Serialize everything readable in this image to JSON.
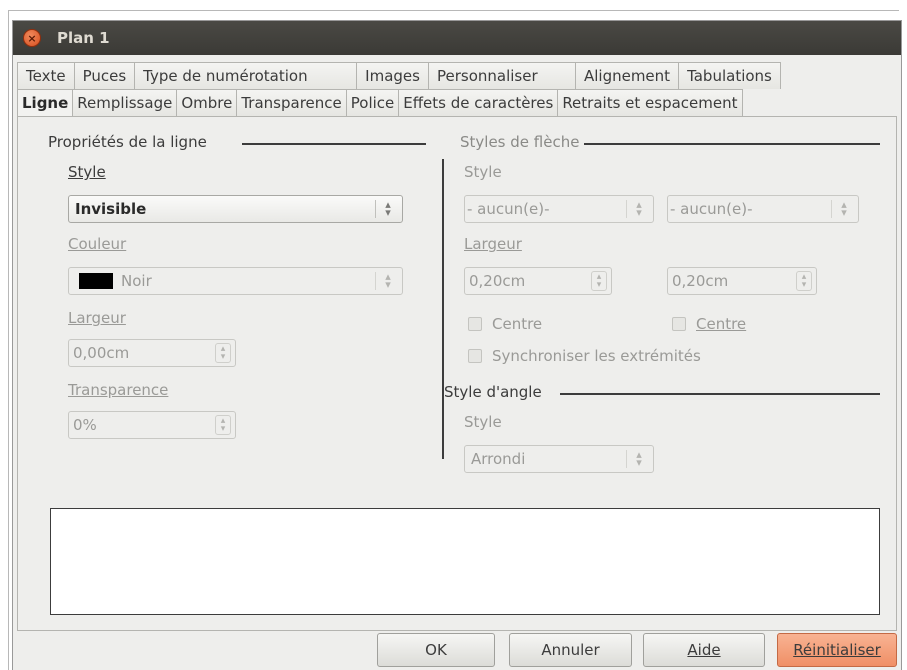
{
  "window": {
    "title": "Plan 1"
  },
  "tabs_row1": [
    "Texte",
    "Puces",
    "Type de numérotation",
    "Images",
    "Personnaliser",
    "Alignement",
    "Tabulations"
  ],
  "tabs_row2": [
    "Ligne",
    "Remplissage",
    "Ombre",
    "Transparence",
    "Police",
    "Effets de caractères",
    "Retraits et espacement"
  ],
  "active_tab": "Ligne",
  "line_props": {
    "heading": "Propriétés de la ligne",
    "style_label": "Style",
    "style_value": "Invisible",
    "color_label": "Couleur",
    "color_value": "Noir",
    "color_swatch": "#000000",
    "width_label": "Largeur",
    "width_value": "0,00cm",
    "transparency_label": "Transparence",
    "transparency_value": "0%"
  },
  "arrow_styles": {
    "heading": "Styles de flèche",
    "style_label": "Style",
    "start_value": "- aucun(e)-",
    "end_value": "- aucun(e)-",
    "width_label": "Largeur",
    "start_width": "0,20cm",
    "end_width": "0,20cm",
    "center_start": "Centre",
    "center_end": "Centre",
    "sync": "Synchroniser les extrémités"
  },
  "corner_style": {
    "heading": "Style d'angle",
    "style_label": "Style",
    "value": "Arrondi"
  },
  "buttons": {
    "ok": "OK",
    "cancel": "Annuler",
    "help": "Aide",
    "reset": "Réinitialiser"
  }
}
